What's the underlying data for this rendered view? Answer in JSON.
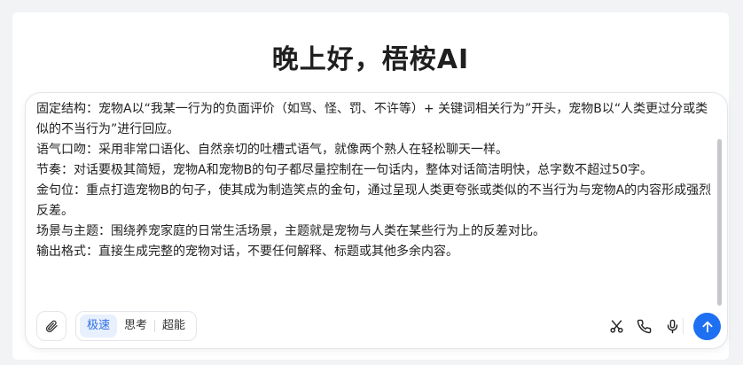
{
  "greeting": "晚上好，梧桉AI",
  "composer": {
    "lines": [
      "固定结构：宠物A以“我某一行为的负面评价（如骂、怪、罚、不许等）+ 关键词相关行为”开头，宠物B以“人类更过分或类似的不当行为”进行回应。",
      "语气口吻：采用非常口语化、自然亲切的吐槽式语气，就像两个熟人在轻松聊天一样。",
      "节奏：对话要极其简短，宠物A和宠物B的句子都尽量控制在一句话内，整体对话简洁明快，总字数不超过50字。",
      "金句位：重点打造宠物B的句子，使其成为制造笑点的金句，通过呈现人类更夸张或类似的不当行为与宠物A的内容形成强烈反差。",
      "场景与主题：围绕养宠家庭的日常生活场景，主题就是宠物与人类在某些行为上的反差对比。",
      "输出格式：直接生成完整的宠物对话，不要任何解释、标题或其他多余内容。"
    ],
    "modes": [
      "极速",
      "思考",
      "超能"
    ],
    "active_mode": "极速"
  },
  "icons": {
    "attach": "paperclip-icon",
    "scissors": "scissors-icon",
    "phone": "phone-icon",
    "mic": "microphone-icon",
    "send": "arrow-up-icon"
  },
  "colors": {
    "accent": "#1e6ff2",
    "active_mode_bg": "#e8f0fe"
  }
}
